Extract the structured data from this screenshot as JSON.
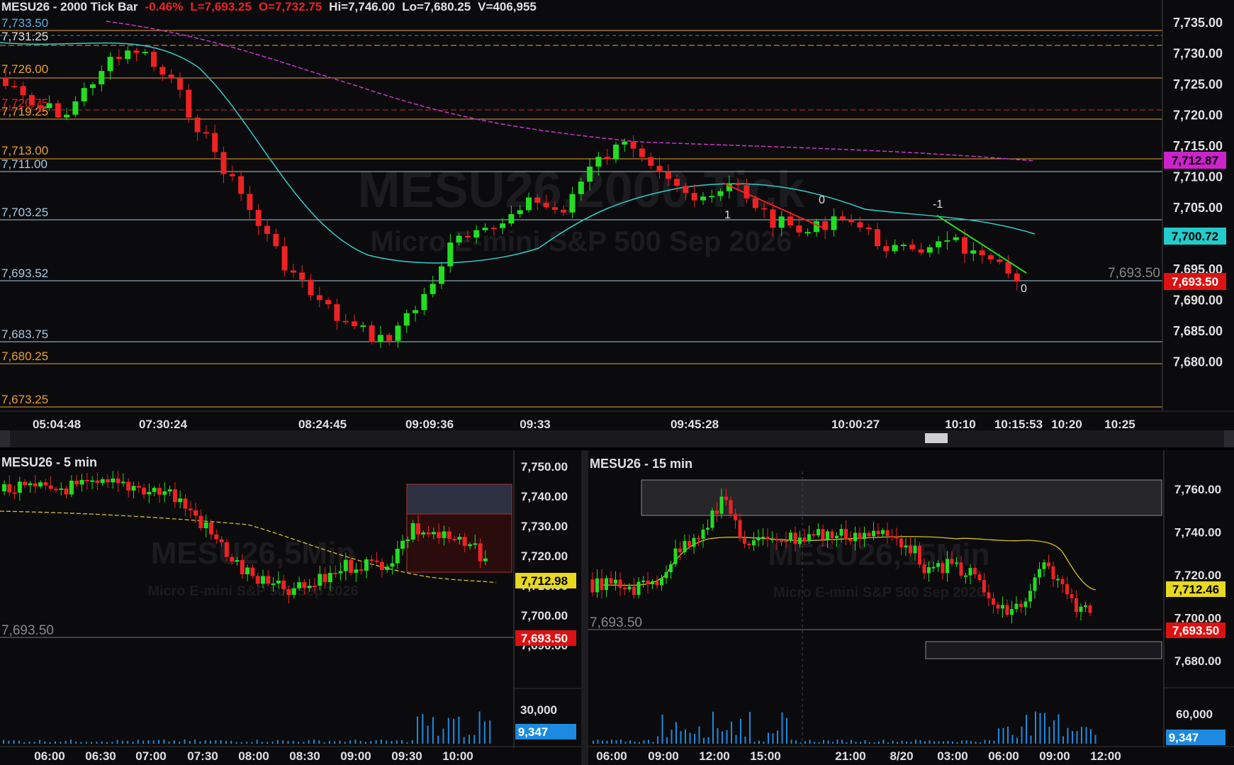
{
  "top": {
    "symbol": "MESU26 - 2000 Tick Bar",
    "change": "-0.46%",
    "last": "L=7,693.25",
    "open": "O=7,732.75",
    "high": "Hi=7,746.00",
    "low": "Lo=7,680.25",
    "volume": "V=406,955",
    "watermark1": "MESU26,2000 Tick",
    "watermark2": "Micro E-mini S&P 500 Sep 2026",
    "price_axis": [
      "7,735.00",
      "7,730.00",
      "7,725.00",
      "7,720.00",
      "7,715.00",
      "7,710.00",
      "7,705.00",
      "7,700.00",
      "7,695.00",
      "7,690.00",
      "7,685.00",
      "7,680.00"
    ],
    "time_axis": [
      "05:04:48",
      "07:30:24",
      "08:24:45",
      "09:09:36",
      "09:33",
      "09:45:28",
      "10:00:27",
      "10:10",
      "10:15:53",
      "10:20",
      "10:25"
    ],
    "level_labels": [
      "7,733.50",
      "7,731.25",
      "7,726.00",
      "7,720.75",
      "7,719.25",
      "7,713.00",
      "7,711.00",
      "7,703.25",
      "7,693.52",
      "7,683.75",
      "7,680.25",
      "7,673.25"
    ],
    "right_labels": {
      "magenta": "7,712.87",
      "cyan": "7,700.72",
      "red": "7,693.50",
      "gray": "7,693.50"
    },
    "trend_labels": [
      "1",
      "0",
      "-1",
      "0"
    ]
  },
  "bottom_left": {
    "title": "MESU26 - 5 min",
    "watermark1": "MESU26,5Min",
    "watermark2": "Micro E-mini S&P 500 Sep 2026",
    "price_axis": [
      "7,750.00",
      "7,740.00",
      "7,730.00",
      "7,720.00",
      "7,710.00",
      "7,700.00",
      "7,690.00"
    ],
    "vol_axis": "30,000",
    "vol_label": "9,347",
    "yellow_label": "7,712.98",
    "red_label": "7,693.50",
    "left_label": "7,693.50",
    "time_axis": [
      "06:00",
      "06:30",
      "07:00",
      "07:30",
      "08:00",
      "08:30",
      "09:00",
      "09:30",
      "10:00"
    ]
  },
  "bottom_right": {
    "title": "MESU26 - 15 min",
    "watermark1": "MESU26,15Min",
    "watermark2": "Micro E-mini S&P 500 Sep 2026",
    "price_axis": [
      "7,760.00",
      "7,740.00",
      "7,720.00",
      "7,700.00",
      "7,680.00"
    ],
    "vol_axis": "60,000",
    "vol_label": "9,347",
    "yellow_label": "7,712.46",
    "red_label": "7,693.50",
    "left_label": "7,693.50",
    "time_axis": [
      "06:00",
      "09:00",
      "12:00",
      "15:00",
      "21:00",
      "8/20",
      "03:00",
      "06:00",
      "09:00",
      "12:00"
    ]
  },
  "colors": {
    "up": "#22dd22",
    "down": "#ee2222",
    "cyan": "#33cccc",
    "magenta": "#cc33cc",
    "orange": "#e8a030",
    "yellow": "#e8d020",
    "bg": "#0b0b0d"
  }
}
